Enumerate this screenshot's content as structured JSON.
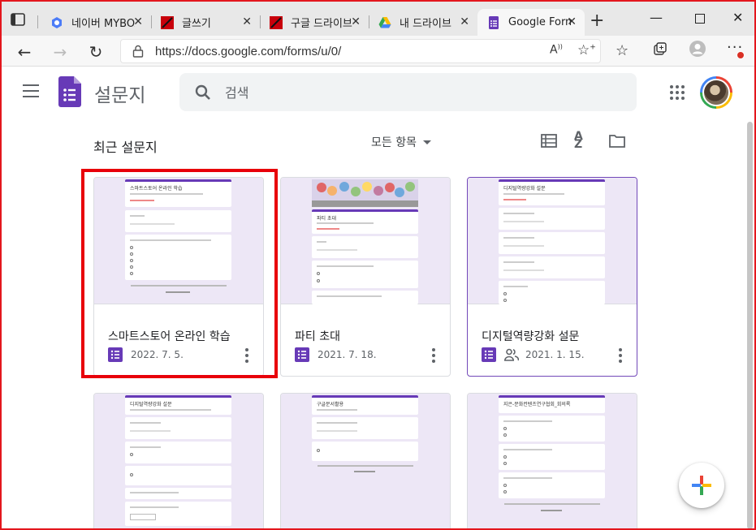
{
  "browser": {
    "tabs": [
      {
        "title": "네이버 MYBOX",
        "active": false,
        "favicon": "mybox-icon",
        "color": "#4c7cf7"
      },
      {
        "title": "글쓰기",
        "active": false,
        "favicon": "red-slash-icon",
        "color": "#c8000b"
      },
      {
        "title": "구글 드라이브",
        "active": false,
        "favicon": "red-slash-icon",
        "color": "#c8000b"
      },
      {
        "title": "내 드라이브",
        "active": false,
        "favicon": "google-drive-icon",
        "color": "#34a853"
      },
      {
        "title": "Google Forms",
        "active": true,
        "favicon": "google-forms-icon",
        "color": "#673ab7"
      }
    ],
    "url": "https://docs.google.com/forms/u/0/"
  },
  "header": {
    "app_title": "설문지",
    "search_placeholder": "검색"
  },
  "section": {
    "title": "최근 설문지",
    "owner_filter": "모든 항목"
  },
  "cards": [
    {
      "name": "스마트스토어 온라인 학습",
      "date": "2022. 7. 5.",
      "shared": false,
      "mini_title": "스마트스토어 온라인 학습",
      "selected": false
    },
    {
      "name": "파티 초대",
      "date": "2021. 7. 18.",
      "shared": false,
      "mini_title": "파티 초대",
      "selected": false
    },
    {
      "name": "디지털역량강화 설문",
      "date": "2021. 1. 15.",
      "shared": true,
      "mini_title": "디지털역량강화 설문",
      "selected": true
    },
    {
      "mini_title": "디지털역량강화 설문"
    },
    {
      "mini_title": "구글문서활용"
    },
    {
      "mini_title": "지은-문화컨텐츠연구협회_회의록"
    }
  ],
  "colors": {
    "accent": "#673ab7",
    "highlight": "#e8000a",
    "border": "#e3161d"
  }
}
